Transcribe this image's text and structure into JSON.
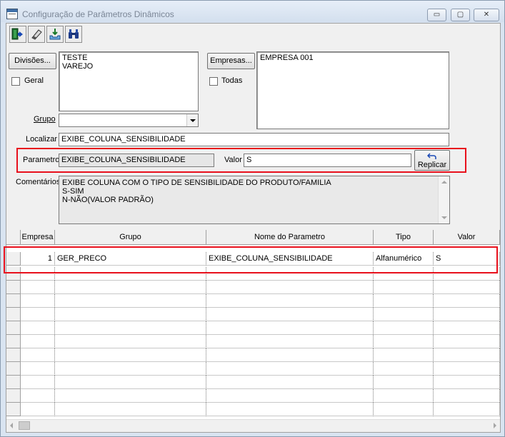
{
  "window": {
    "title": "Configuração de Parâmetros Dinâmicos",
    "minimize_glyph": "▭",
    "maximize_glyph": "▢",
    "close_glyph": "✕"
  },
  "toolbar": {
    "buttons": [
      {
        "icon": "exit-door-icon"
      },
      {
        "icon": "eraser-icon"
      },
      {
        "icon": "save-tray-icon"
      },
      {
        "icon": "binoculars-icon"
      }
    ]
  },
  "divisoes": {
    "button_label": "Divisões...",
    "items": [
      "TESTE",
      "VAREJO"
    ],
    "geral_label": "Geral",
    "geral_checked": false
  },
  "empresas": {
    "button_label": "Empresas...",
    "items": [
      "EMPRESA 001"
    ],
    "todas_label": "Todas",
    "todas_checked": false
  },
  "grupo": {
    "label": "Grupo",
    "value": ""
  },
  "localizar": {
    "label": "Localizar",
    "value": "EXIBE_COLUNA_SENSIBILIDADE"
  },
  "parametro": {
    "label": "Parametro",
    "value": "EXIBE_COLUNA_SENSIBILIDADE"
  },
  "valor": {
    "label": "Valor",
    "value": "S"
  },
  "replicar": {
    "label": "Replicar",
    "icon": "undo-arrow-icon"
  },
  "comentarios": {
    "label": "Comentários",
    "lines": [
      "EXIBE COLUNA COM O TIPO DE SENSIBILIDADE DO PRODUTO/FAMILIA",
      "S-SIM",
      "N-NÃO(VALOR PADRÃO)"
    ]
  },
  "table": {
    "columns": [
      "Empresa",
      "Grupo",
      "Nome do Parametro",
      "Tipo",
      "Valor"
    ],
    "rows": [
      {
        "empresa": "1",
        "grupo": "GER_PRECO",
        "nome": "EXIBE_COLUNA_SENSIBILIDADE",
        "tipo": "Alfanumérico",
        "valor": "S"
      }
    ]
  },
  "colors": {
    "highlight": "#e8101c"
  }
}
